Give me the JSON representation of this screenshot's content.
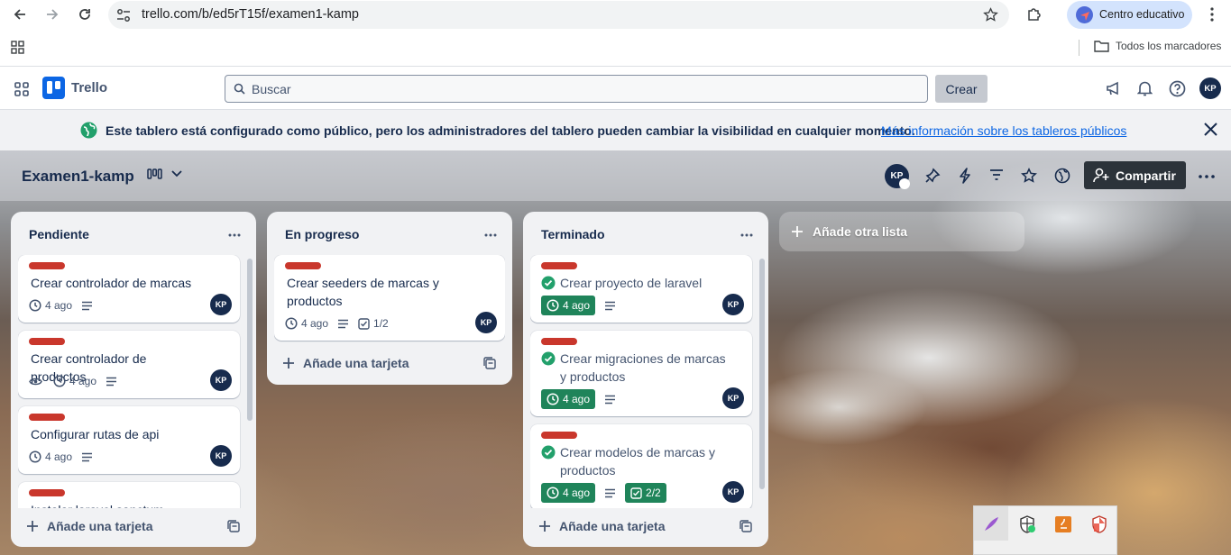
{
  "browser": {
    "url": "trello.com/b/ed5rT15f/examen1-kamp",
    "profile_name": "Centro educativo",
    "bookmarks_all": "Todos los marcadores"
  },
  "header": {
    "brand": "Trello",
    "search_placeholder": "Buscar",
    "create_label": "Crear",
    "avatar_initials": "KP"
  },
  "banner": {
    "text": "Este tablero está configurado como público, pero los administradores del tablero pueden cambiar la visibilidad en cualquier momento.",
    "link": "Más información sobre los tableros públicos"
  },
  "board": {
    "title": "Examen1-kamp",
    "member_initials": "KP",
    "share_label": "Compartir",
    "add_list_label": "Añade otra lista",
    "lists": [
      {
        "title": "Pendiente",
        "add_card_label": "Añade una tarjeta",
        "cards": [
          {
            "title": "Crear controlador de marcas",
            "date": "4 ago",
            "member": "KP"
          },
          {
            "title": "Crear controlador de productos",
            "date": "4 ago",
            "member": "KP"
          },
          {
            "title": "Configurar rutas de api",
            "date": "4 ago",
            "member": "KP"
          },
          {
            "title": "Instalar laravel sanctum",
            "date": "",
            "member": ""
          }
        ]
      },
      {
        "title": "En progreso",
        "add_card_label": "Añade una tarjeta",
        "cards": [
          {
            "title": "Crear seeders de marcas y productos",
            "date": "4 ago",
            "checklist": "1/2",
            "member": "KP"
          }
        ]
      },
      {
        "title": "Terminado",
        "add_card_label": "Añade una tarjeta",
        "cards": [
          {
            "title": "Crear proyecto de laravel",
            "date": "4 ago",
            "member": "KP"
          },
          {
            "title": "Crear migraciones de marcas y productos",
            "date": "4 ago",
            "member": "KP"
          },
          {
            "title": "Crear modelos de marcas y productos",
            "date": "4 ago",
            "checklist": "2/2",
            "member": "KP"
          }
        ]
      }
    ]
  },
  "colors": {
    "label_red": "#c9372c",
    "done_green": "#1f845a",
    "link_blue": "#0c66e4",
    "avatar_navy": "#172b4d"
  }
}
